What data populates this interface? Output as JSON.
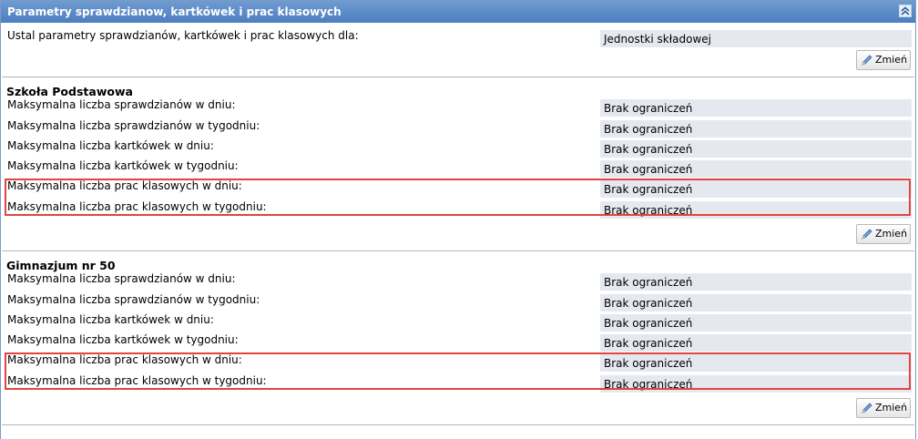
{
  "panel": {
    "title": "Parametry sprawdzianow, kartkówek i prac klasowych",
    "collapse_icon": "double-chevron-up-icon"
  },
  "intro": {
    "label": "Ustal parametry sprawdzianów, kartkówek i prac klasowych dla:",
    "value": "Jednostki składowej"
  },
  "change_button_label": "Zmień",
  "highlight_color": "#e0453f",
  "sections": [
    {
      "title": "Szkoła Podstawowa",
      "rows": [
        {
          "label": "Maksymalna liczba sprawdzianów w dniu:",
          "value": "Brak ograniczeń"
        },
        {
          "label": "Maksymalna liczba sprawdzianów w tygodniu:",
          "value": "Brak ograniczeń"
        },
        {
          "label": "Maksymalna liczba kartkówek w dniu:",
          "value": "Brak ograniczeń"
        },
        {
          "label": "Maksymalna liczba kartkówek w tygodniu:",
          "value": "Brak ograniczeń"
        },
        {
          "label": "Maksymalna liczba prac klasowych w dniu:",
          "value": "Brak ograniczeń"
        },
        {
          "label": "Maksymalna liczba prac klasowych w tygodniu:",
          "value": "Brak ograniczeń"
        }
      ]
    },
    {
      "title": "Gimnazjum nr 50",
      "rows": [
        {
          "label": "Maksymalna liczba sprawdzianów w dniu:",
          "value": "Brak ograniczeń"
        },
        {
          "label": "Maksymalna liczba sprawdzianów w tygodniu:",
          "value": "Brak ograniczeń"
        },
        {
          "label": "Maksymalna liczba kartkówek w dniu:",
          "value": "Brak ograniczeń"
        },
        {
          "label": "Maksymalna liczba kartkówek w tygodniu:",
          "value": "Brak ograniczeń"
        },
        {
          "label": "Maksymalna liczba prac klasowych w dniu:",
          "value": "Brak ograniczeń"
        },
        {
          "label": "Maksymalna liczba prac klasowych w tygodniu:",
          "value": "Brak ograniczeń"
        }
      ]
    }
  ]
}
